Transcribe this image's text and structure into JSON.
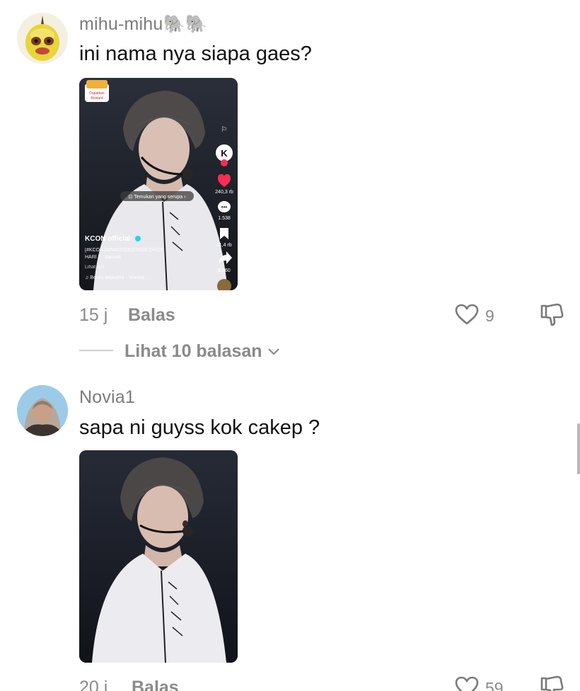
{
  "comments": [
    {
      "username": "mihu-mihu🐘🐘",
      "text": "ini nama nya siapa gaes?",
      "time": "15 j",
      "reply_label": "Balas",
      "likes": "9",
      "view_replies": "Lihat 10 balasan",
      "media": {
        "reward_badge": "Dapatkan Reward",
        "find_similar": "Temukan yang serupa",
        "account": "KCON official",
        "caption": "[#KCONJAPAN2024]STAGE DROP HARI 2...banyak",
        "see_original": "Lihat asli",
        "sound": "Berisi: Beautiful - Wanna ...",
        "likes": "240,3 rb",
        "comments": "1.538",
        "saves": "11,4 rb",
        "shares": "8.860"
      }
    },
    {
      "username": "Novia1",
      "text": "sapa ni guyss kok cakep ?",
      "time": "20 j",
      "reply_label": "Balas",
      "likes": "59"
    }
  ],
  "colors": {
    "text_primary": "#111111",
    "text_secondary": "#8a8a8a",
    "like_red": "#fe2c55"
  }
}
